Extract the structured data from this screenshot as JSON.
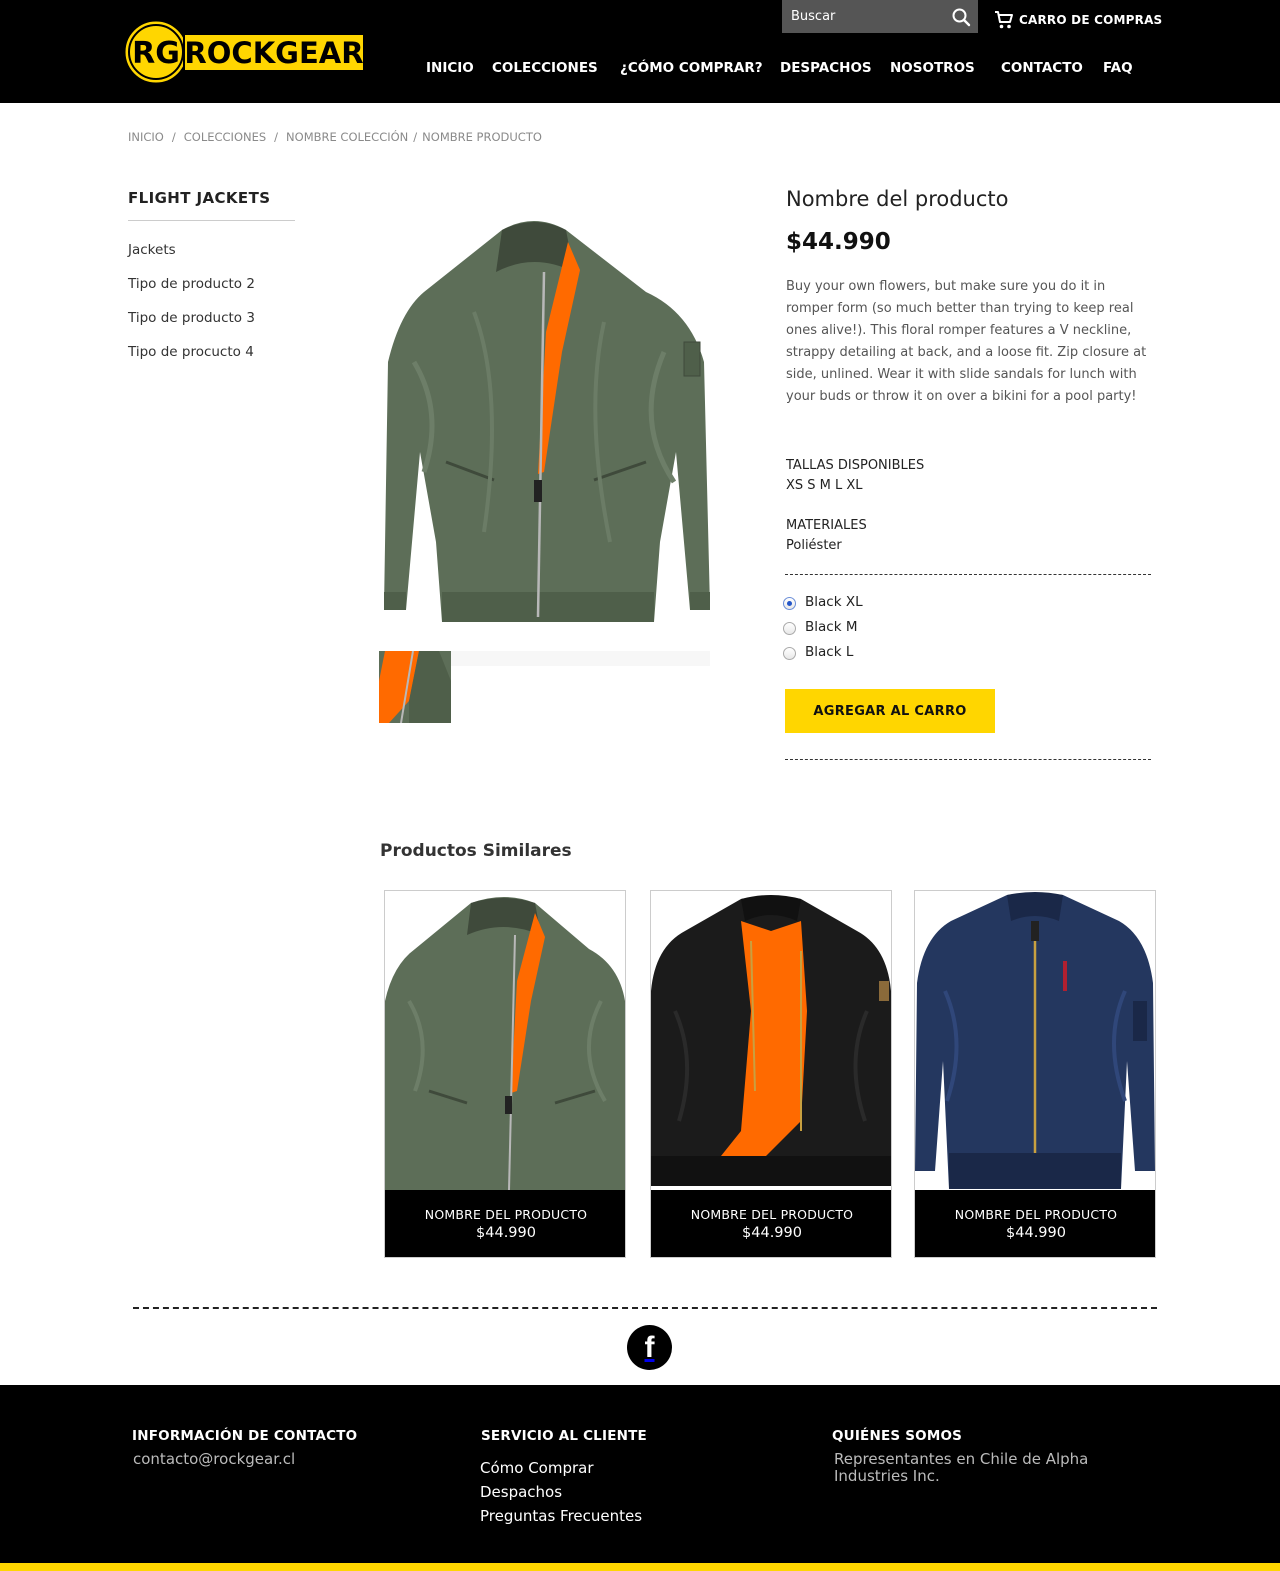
{
  "brand": {
    "name": "ROCKGEAR",
    "logo_letters": "RG"
  },
  "header": {
    "search_placeholder": "Buscar",
    "cart_label": "CARRO DE COMPRAS",
    "nav": [
      {
        "label": "INICIO"
      },
      {
        "label": "COLECCIONES"
      },
      {
        "label": "¿CÓMO COMPRAR?"
      },
      {
        "label": "DESPACHOS"
      },
      {
        "label": "NOSOTROS"
      },
      {
        "label": "CONTACTO"
      },
      {
        "label": "FAQ"
      }
    ]
  },
  "breadcrumb": {
    "items": [
      "INICIO",
      "COLECCIONES",
      "NOMBRE COLECCIÓN",
      "NOMBRE PRODUCTO"
    ],
    "separator": "/"
  },
  "sidebar": {
    "title": "FLIGHT JACKETS",
    "items": [
      {
        "label": "Jackets"
      },
      {
        "label": "Tipo de producto 2"
      },
      {
        "label": "Tipo de producto 3"
      },
      {
        "label": "Tipo de procucto 4"
      }
    ]
  },
  "product": {
    "name": "Nombre del producto",
    "price": "$44.990",
    "description": "Buy your own flowers, but make sure you do it in romper form (so much better than trying to keep real ones alive!). This floral romper features a V neckline, strappy detailing at back, and a loose fit. Zip closure at side, unlined. Wear it with slide sandals for lunch with your buds or throw it on over a bikini for a pool party!",
    "sizes_label": "TALLAS DISPONIBLES",
    "sizes": "XS S M L XL",
    "materials_label": "MATERIALES",
    "materials": "Poliéster",
    "options": [
      {
        "label": "Black XL",
        "selected": true
      },
      {
        "label": "Black M",
        "selected": false
      },
      {
        "label": "Black L",
        "selected": false
      }
    ],
    "add_to_cart": "AGREGAR AL CARRO"
  },
  "similar": {
    "title": "Productos Similares",
    "items": [
      {
        "name": "NOMBRE DEL PRODUCTO",
        "price": "$44.990",
        "color": "#5d6e58"
      },
      {
        "name": "NOMBRE DEL PRODUCTO",
        "price": "$44.990",
        "color": "#1b1b1b"
      },
      {
        "name": "NOMBRE DEL PRODUCTO",
        "price": "$44.990",
        "color": "#24375f"
      }
    ]
  },
  "social": {
    "facebook_glyph": "f"
  },
  "footer": {
    "contact": {
      "title": "INFORMACIÓN DE CONTACTO",
      "email": "contacto@rockgear.cl"
    },
    "service": {
      "title": "SERVICIO AL CLIENTE",
      "links": [
        "Cómo Comprar",
        "Despachos",
        "Preguntas Frecuentes"
      ]
    },
    "about": {
      "title": "QUIÉNES SOMOS",
      "text": "Representantes en Chile de Alpha Industries Inc."
    }
  },
  "colors": {
    "header_bg": "#000000",
    "accent_yellow": "#ffd600",
    "lining_orange": "#ff6a00",
    "jacket_green": "#5d6e58",
    "jacket_black": "#1b1b1b",
    "jacket_navy": "#24375f"
  }
}
